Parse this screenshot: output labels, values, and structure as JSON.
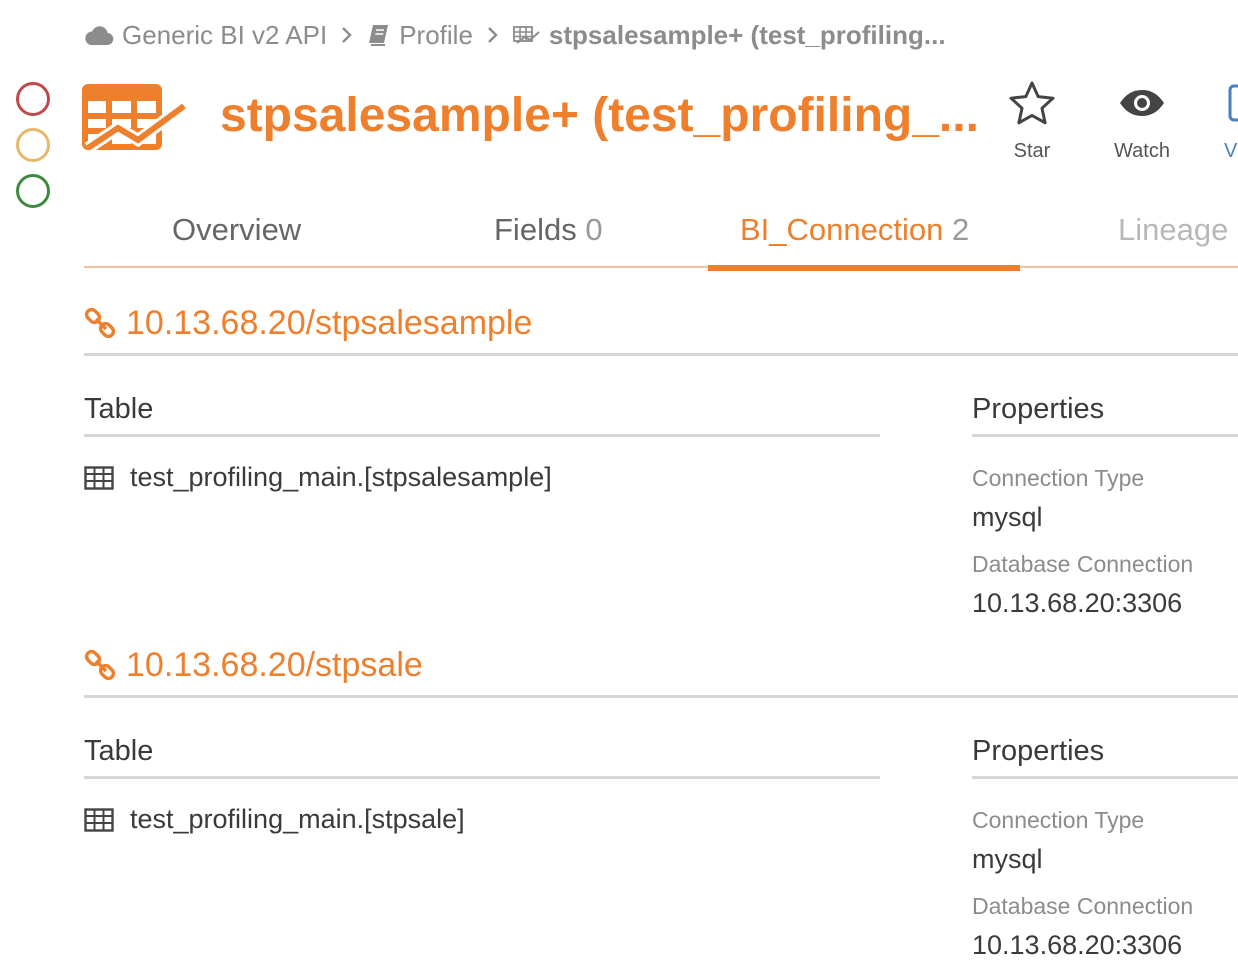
{
  "breadcrumb": {
    "items": [
      {
        "label": "Generic BI v2 API",
        "icon": "cloud-icon"
      },
      {
        "label": "Profile",
        "icon": "book-icon"
      },
      {
        "label": "stpsalesample+ (test_profiling...",
        "icon": "report-icon"
      }
    ]
  },
  "status_indicators": [
    {
      "name": "red",
      "color": "#c0494a"
    },
    {
      "name": "yellow",
      "color": "#e8b86a"
    },
    {
      "name": "green",
      "color": "#3e8a3e"
    }
  ],
  "header": {
    "title": "stpsalesample+ (test_profiling_...",
    "icon": "bi-report-icon",
    "actions": [
      {
        "label": "Star",
        "icon": "star-icon"
      },
      {
        "label": "Watch",
        "icon": "eye-icon"
      },
      {
        "label": "V",
        "icon": "partial-button"
      }
    ]
  },
  "tabs": [
    {
      "label": "Overview",
      "count": ""
    },
    {
      "label": "Fields",
      "count": "0"
    },
    {
      "label": "BI_Connection",
      "count": "2",
      "active": true
    },
    {
      "label": "Lineage",
      "count": ""
    }
  ],
  "colors": {
    "accent": "#ee7f2d",
    "muted": "#8c8c8c",
    "text": "#3a3a3a"
  },
  "connections": [
    {
      "title": "10.13.68.20/stpsalesample",
      "table_header": "Table",
      "properties_header": "Properties",
      "table": "test_profiling_main.[stpsalesample]",
      "properties": {
        "connection_type_label": "Connection Type",
        "connection_type": "mysql",
        "database_connection_label": "Database Connection",
        "database_connection": "10.13.68.20:3306"
      }
    },
    {
      "title": "10.13.68.20/stpsale",
      "table_header": "Table",
      "properties_header": "Properties",
      "table": "test_profiling_main.[stpsale]",
      "properties": {
        "connection_type_label": "Connection Type",
        "connection_type": "mysql",
        "database_connection_label": "Database Connection",
        "database_connection": "10.13.68.20:3306"
      }
    }
  ]
}
